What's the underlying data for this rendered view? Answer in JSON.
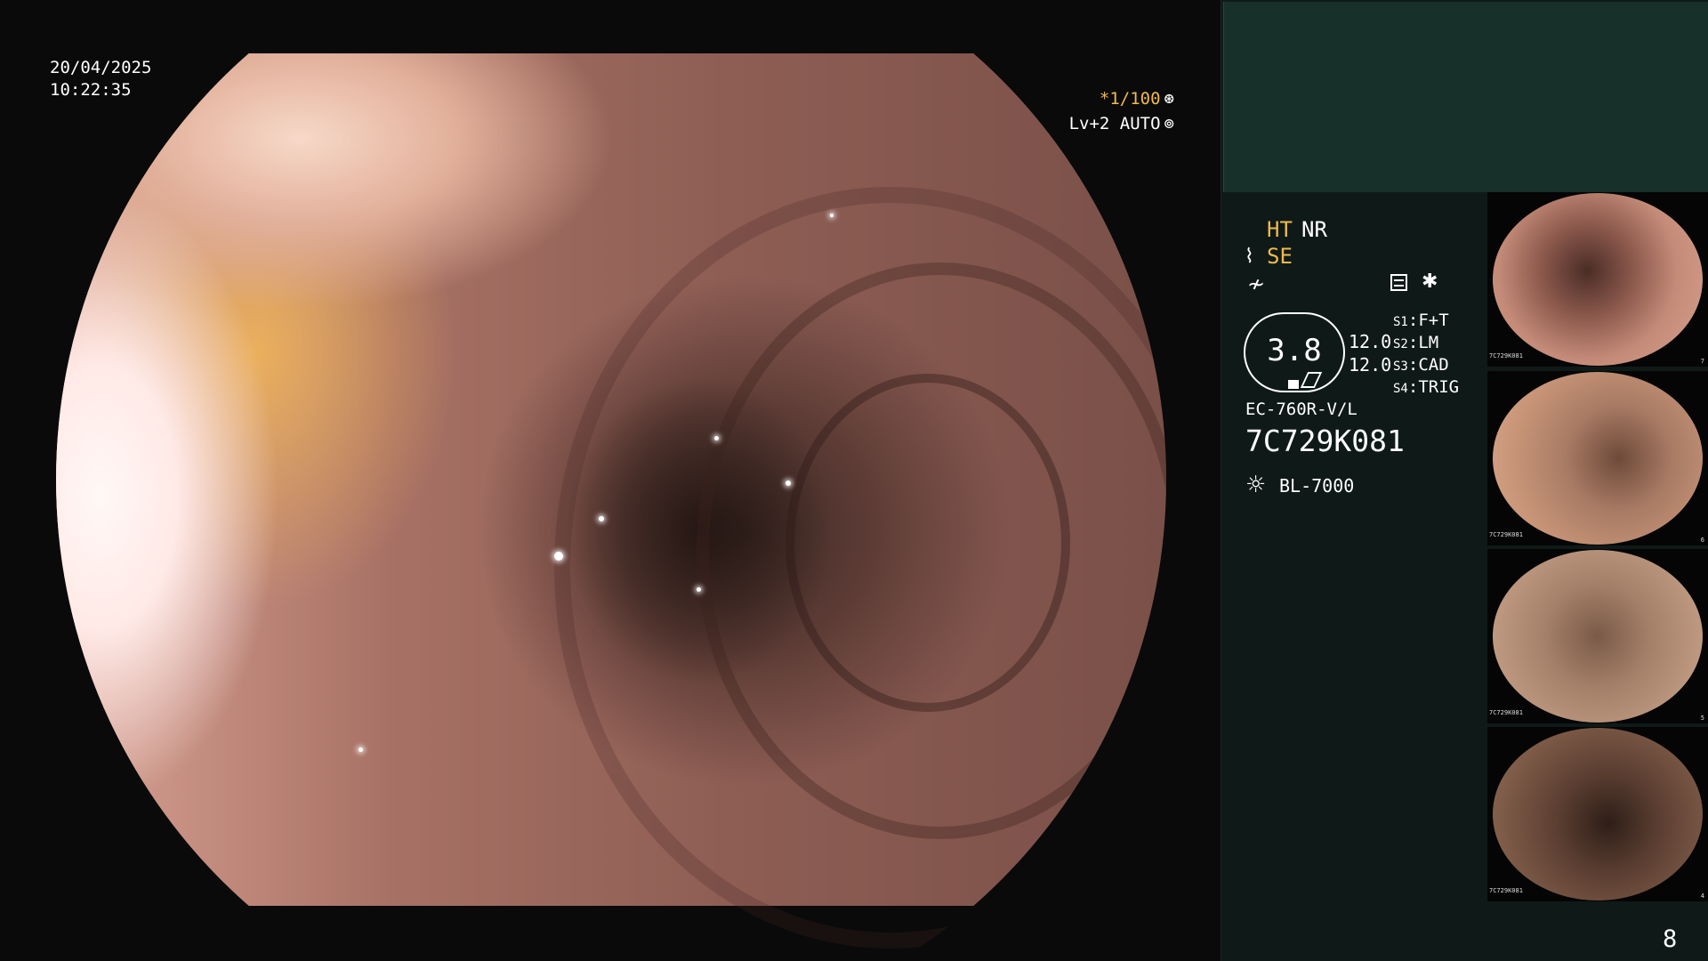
{
  "overlay": {
    "date": "20/04/2025",
    "time": "10:22:35",
    "exposure": "*1/100",
    "level_auto": "Lv+2 AUTO"
  },
  "panel": {
    "mode_ht": "HT",
    "mode_nr": "NR",
    "mode_se": "SE",
    "badge_value": "3.8",
    "value_a": "12.0",
    "value_b": "12.0",
    "switches": [
      {
        "key": "S1",
        "value": "F+T"
      },
      {
        "key": "S2",
        "value": "LM"
      },
      {
        "key": "S3",
        "value": "CAD"
      },
      {
        "key": "S4",
        "value": "TRIG"
      }
    ],
    "scope_model": "EC-760R-V/L",
    "scope_serial": "7C729K081",
    "light_source": "BL-7000",
    "icons": {
      "exposure": "aperture-icon",
      "auto": "auto-iris-icon",
      "se": "se-icon",
      "freq": "frequency-icon",
      "settings": "settings-list-icon",
      "star": "star-icon",
      "light": "light-source-icon"
    }
  },
  "thumbnails": [
    {
      "serial": "7C729K081",
      "num": "7"
    },
    {
      "serial": "7C729K081",
      "num": "6"
    },
    {
      "serial": "7C729K081",
      "num": "5"
    },
    {
      "serial": "7C729K081",
      "num": "4"
    }
  ],
  "page_number": "8"
}
